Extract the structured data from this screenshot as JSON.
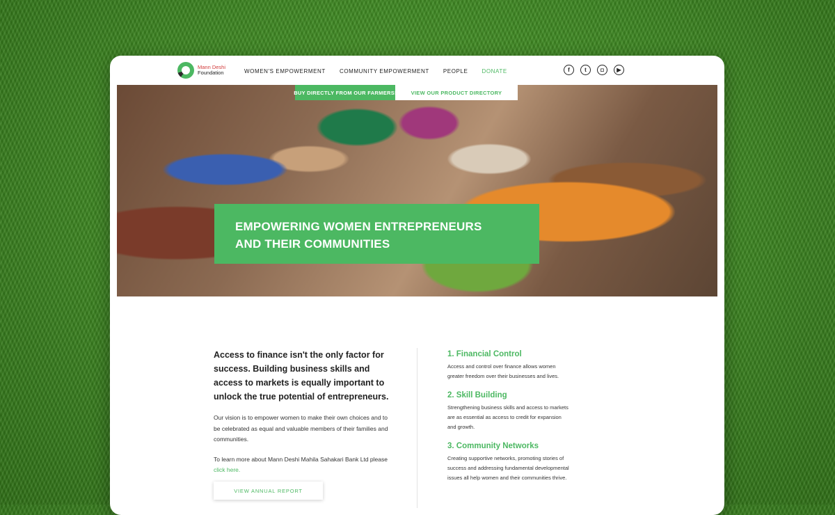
{
  "nav": {
    "logo_line1": "Mann Deshi",
    "logo_line2": "Foundation",
    "items": [
      {
        "label": "WOMEN'S EMPOWERMENT"
      },
      {
        "label": "COMMUNITY EMPOWERMENT"
      },
      {
        "label": "PEOPLE"
      },
      {
        "label": "DONATE"
      }
    ],
    "social": [
      {
        "icon": "facebook-icon",
        "glyph": "f"
      },
      {
        "icon": "twitter-icon",
        "glyph": "t"
      },
      {
        "icon": "instagram-icon",
        "glyph": "◘"
      },
      {
        "icon": "youtube-icon",
        "glyph": "▶"
      }
    ]
  },
  "hero": {
    "tab_farmers": "BUY DIRECTLY FROM OUR FARMERS!",
    "tab_directory": "VIEW OUR PRODUCT DIRECTORY",
    "headline_line1": "EMPOWERING WOMEN ENTREPRENEURS",
    "headline_line2": "AND THEIR COMMUNITIES"
  },
  "intro": {
    "lead": "Access to finance isn't the only factor for success. Building business skills and access to markets is equally important to unlock the true potential of entrepreneurs.",
    "para1": "Our vision is to empower women to make their own choices and to be celebrated as equal and valuable members of their families and communities.",
    "para2_prefix": "To learn more about Mann Deshi Mahila Sahakari Bank Ltd please ",
    "para2_link": "click here.",
    "report_button": "VIEW ANNUAL REPORT"
  },
  "pillars": [
    {
      "title": "1. Financial Control",
      "text": "Access and control over finance allows women greater freedom over their businesses and lives."
    },
    {
      "title": "2. Skill Building",
      "text": "Strengthening business skills and access to markets are as essential as access to credit for expansion and growth."
    },
    {
      "title": "3. Community Networks",
      "text": "Creating supportive networks, promoting stories of success and addressing fundamental developmental issues all help women and their communities thrive."
    }
  ],
  "colors": {
    "accent": "#4cb862",
    "logo_red": "#d23b3b",
    "text": "#222222"
  }
}
